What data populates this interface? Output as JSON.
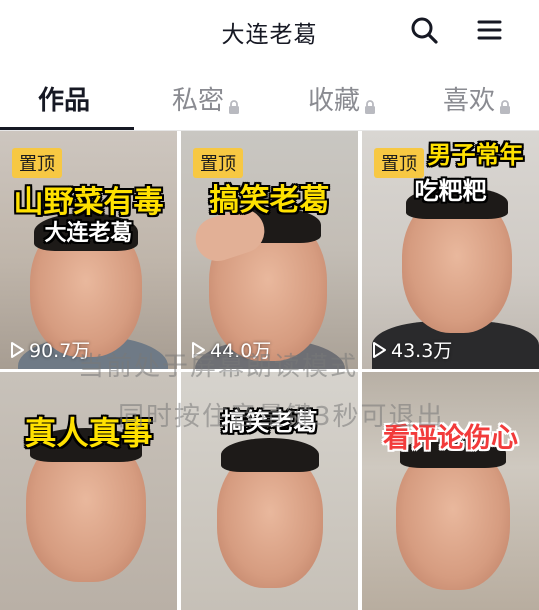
{
  "header": {
    "title": "大连老葛"
  },
  "tabs": [
    {
      "label": "作品",
      "active": true,
      "locked": false
    },
    {
      "label": "私密",
      "active": false,
      "locked": true
    },
    {
      "label": "收藏",
      "active": false,
      "locked": true
    },
    {
      "label": "喜欢",
      "active": false,
      "locked": true
    }
  ],
  "videos": [
    {
      "pinned_label": "置顶",
      "caption_lines": [
        "山野菜有毒",
        "大连老葛"
      ],
      "plays": "90.7万"
    },
    {
      "pinned_label": "置顶",
      "caption_lines": [
        "搞笑老葛"
      ],
      "plays": "44.0万"
    },
    {
      "pinned_label": "置顶",
      "caption_lines": [
        "男子常年",
        "吃粑粑"
      ],
      "plays": "43.3万"
    },
    {
      "caption_lines": [
        "真人真事"
      ]
    },
    {
      "caption_lines": [
        "搞笑老葛"
      ]
    },
    {
      "caption_lines": [
        "看评论伤心"
      ]
    }
  ],
  "accessibility_overlay": {
    "line1": "当前处于屏幕朗读模式",
    "line2": "同时按住音量键3秒可退出"
  },
  "colors": {
    "pin_badge": "#f7c843",
    "caption_yellow": "#ffe100",
    "caption_red": "#f23b3b",
    "active_tab": "#161823",
    "inactive_tab": "#8a8b91"
  }
}
